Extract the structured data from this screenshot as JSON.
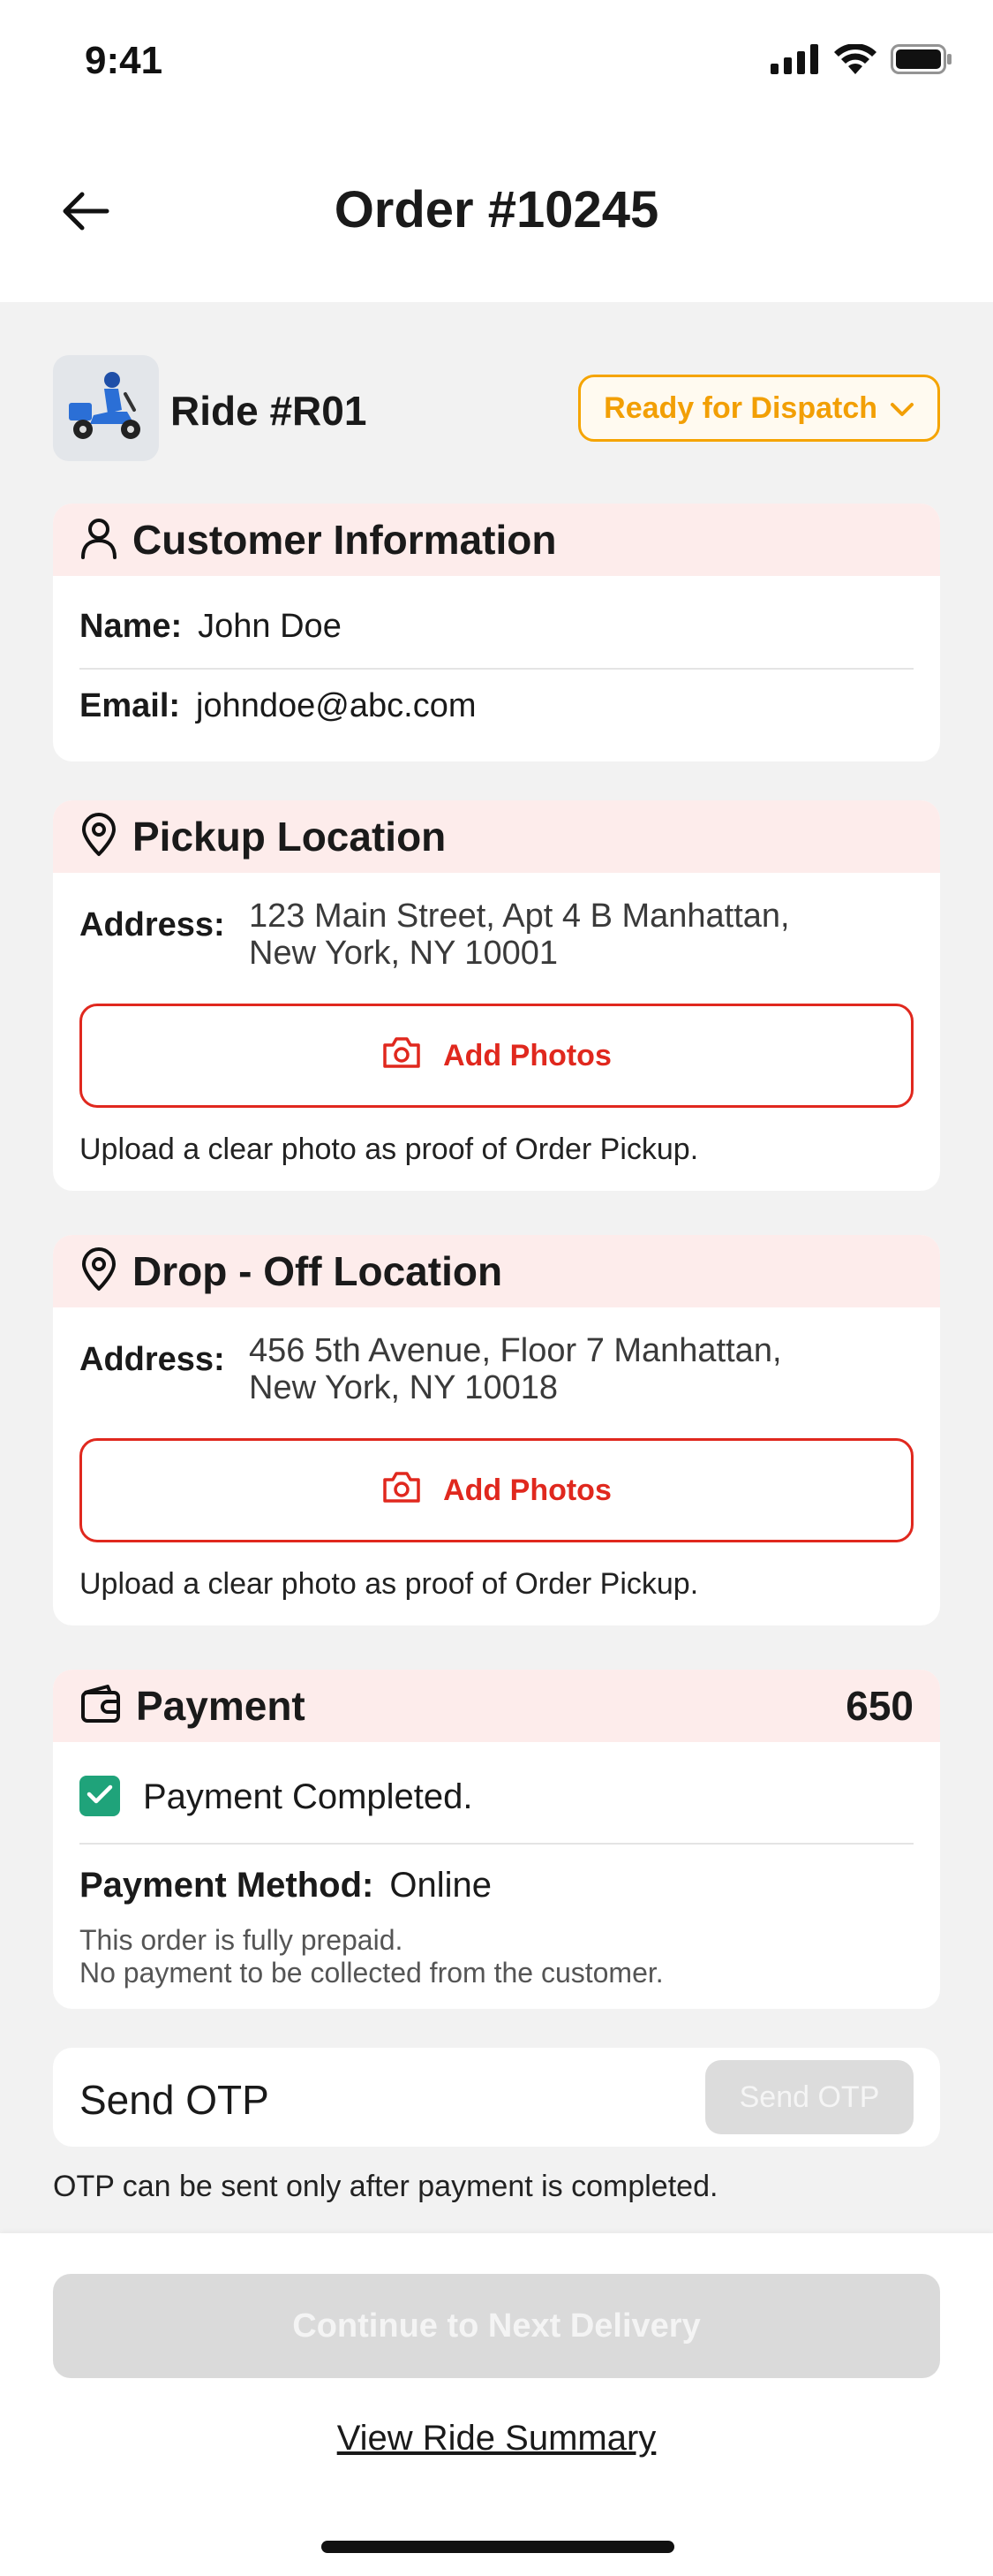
{
  "status_bar": {
    "time": "9:41",
    "icons": [
      "signal-icon",
      "wifi-icon",
      "battery-icon"
    ]
  },
  "header": {
    "title": "Order #10245",
    "back_icon": "back-arrow-icon"
  },
  "ride": {
    "label": "Ride #R01",
    "avatar_icon": "scooter-rider-icon",
    "status": {
      "label": "Ready for Dispatch",
      "color": "#F29F05"
    }
  },
  "customer": {
    "title": "Customer Information",
    "icon": "user-icon",
    "name_label": "Name:",
    "name": "John Doe",
    "email_label": "Email:",
    "email": "johndoe@abc.com"
  },
  "pickup": {
    "title": "Pickup Location",
    "icon": "location-pin-icon",
    "address_label": "Address:",
    "address_line1": "123 Main Street, Apt 4 B Manhattan,",
    "address_line2": "New York, NY 10001",
    "photo_button": "Add Photos",
    "hint": "Upload a clear photo as proof of Order Pickup."
  },
  "dropoff": {
    "title": "Drop - Off Location",
    "icon": "location-pin-icon",
    "address_label": "Address:",
    "address_line1": "456 5th Avenue, Floor 7 Manhattan,",
    "address_line2": "New York, NY 10018",
    "photo_button": "Add Photos",
    "hint": "Upload a clear photo as proof of Order Pickup."
  },
  "payment": {
    "title": "Payment",
    "icon": "wallet-icon",
    "amount": "650",
    "completed": true,
    "status": "Payment Completed.",
    "method_label": "Payment Method:",
    "method": "Online",
    "note_line1": "This order is fully prepaid.",
    "note_line2": "No payment to be collected from the customer."
  },
  "otp": {
    "title": "Send OTP",
    "button": "Send OTP",
    "button_enabled": false,
    "hint": "OTP can be sent only after payment is completed."
  },
  "footer": {
    "continue_button": "Continue to Next Delivery",
    "continue_enabled": false,
    "summary_link": "View Ride Summary"
  },
  "colors": {
    "accent_red": "#E0281E",
    "header_tint": "#FDECEB",
    "success_green": "#1FA37A",
    "dispatch_orange": "#F5A400"
  }
}
